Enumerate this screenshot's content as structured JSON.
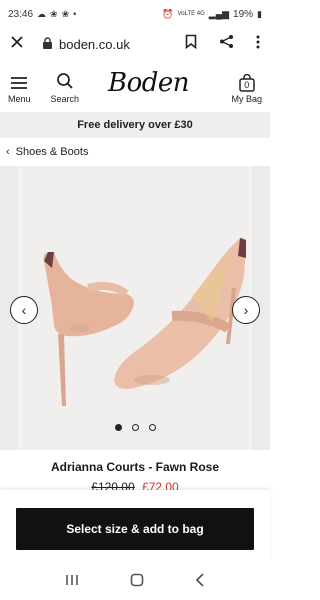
{
  "status_bar": {
    "time": "23:46",
    "left_icons": [
      "cloud-icon",
      "paw-icon",
      "paw-icon",
      "dot-icon"
    ],
    "right_icons": [
      "alarm-icon",
      "wifi-icon",
      "signal-icon"
    ],
    "network": "VoLTE 4G",
    "battery": "19%"
  },
  "browser": {
    "url": "boden.co.uk"
  },
  "header": {
    "menu_label": "Menu",
    "search_label": "Search",
    "logo": "Boden",
    "bag_label": "My Bag",
    "bag_count": "0"
  },
  "banner": {
    "text": "Free delivery over £30"
  },
  "breadcrumb": {
    "label": "Shoes & Boots"
  },
  "gallery": {
    "slide_count": 3,
    "active_index": 0
  },
  "product": {
    "name": "Adrianna Courts - Fawn Rose",
    "price_was": "£120.00",
    "price_now": "£72.00"
  },
  "cta": {
    "label": "Select size & add to bag"
  },
  "colors": {
    "accent": "#111111",
    "sale": "#d0342c",
    "shoe": "#e8b79d"
  }
}
